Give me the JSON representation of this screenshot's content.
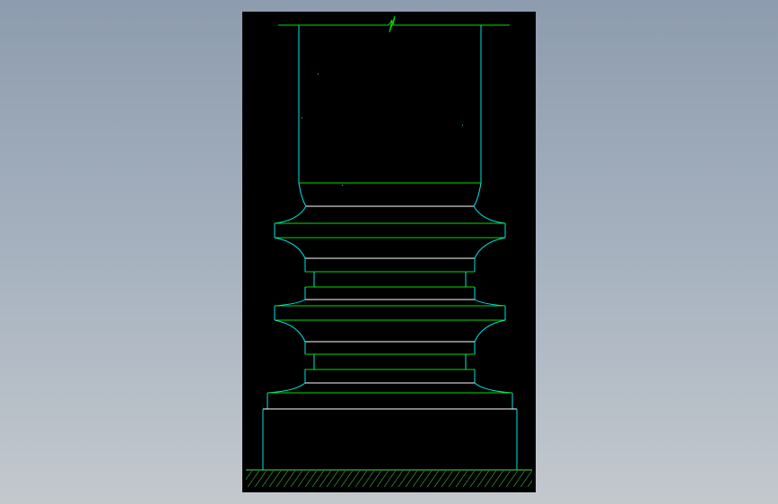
{
  "app": {
    "title": ""
  },
  "drawing": {
    "description_label": "",
    "colors": {
      "background": "#000000",
      "cyan_edges": "#00e5e5",
      "green_edges": "#00e000",
      "white_edges": "#ffffff",
      "hatch": "#4ee04e",
      "window_bg_top": "#8d9cae",
      "window_bg_bottom": "#c3c8cd"
    },
    "components": [
      {
        "name": "column-shaft",
        "kind": "shaft"
      },
      {
        "name": "upper-flare",
        "kind": "transition"
      },
      {
        "name": "upper-torus",
        "kind": "molding"
      },
      {
        "name": "upper-fillet-band",
        "kind": "band"
      },
      {
        "name": "upper-scotia-band",
        "kind": "band"
      },
      {
        "name": "middle-torus",
        "kind": "molding"
      },
      {
        "name": "lower-fillet-band",
        "kind": "band"
      },
      {
        "name": "lower-scotia-band",
        "kind": "band"
      },
      {
        "name": "lower-flare",
        "kind": "transition"
      },
      {
        "name": "plinth-step",
        "kind": "base"
      },
      {
        "name": "pedestal-block",
        "kind": "base"
      },
      {
        "name": "ground-hatch",
        "kind": "ground"
      }
    ],
    "break_symbol": "break-line-symbol"
  }
}
